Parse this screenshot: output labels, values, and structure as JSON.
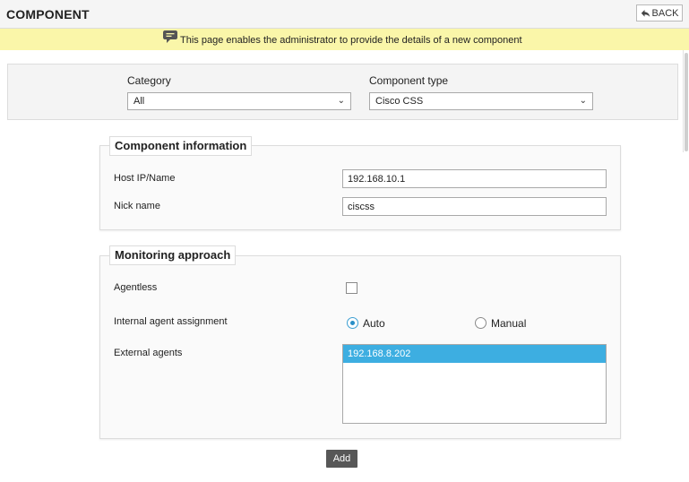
{
  "header": {
    "title": "COMPONENT",
    "back_label": "BACK"
  },
  "info_bar": {
    "message": "This page enables the administrator to provide the details of a new component"
  },
  "filters": {
    "category": {
      "label": "Category",
      "value": "All"
    },
    "component_type": {
      "label": "Component type",
      "value": "Cisco CSS"
    }
  },
  "component_info": {
    "legend": "Component information",
    "host": {
      "label": "Host IP/Name",
      "value": "192.168.10.1"
    },
    "nick": {
      "label": "Nick name",
      "value": "ciscss"
    }
  },
  "monitoring": {
    "legend": "Monitoring approach",
    "agentless": {
      "label": "Agentless",
      "checked": false
    },
    "internal_agent": {
      "label": "Internal agent assignment",
      "options": [
        "Auto",
        "Manual"
      ],
      "selected": "Auto"
    },
    "external_agents": {
      "label": "External agents",
      "items": [
        "192.168.8.202"
      ]
    }
  },
  "actions": {
    "add_label": "Add"
  },
  "colors": {
    "info_bar": "#faf6a9",
    "selected_item": "#3daee1",
    "radio_accent": "#2a8fc7",
    "add_button": "#575757"
  }
}
